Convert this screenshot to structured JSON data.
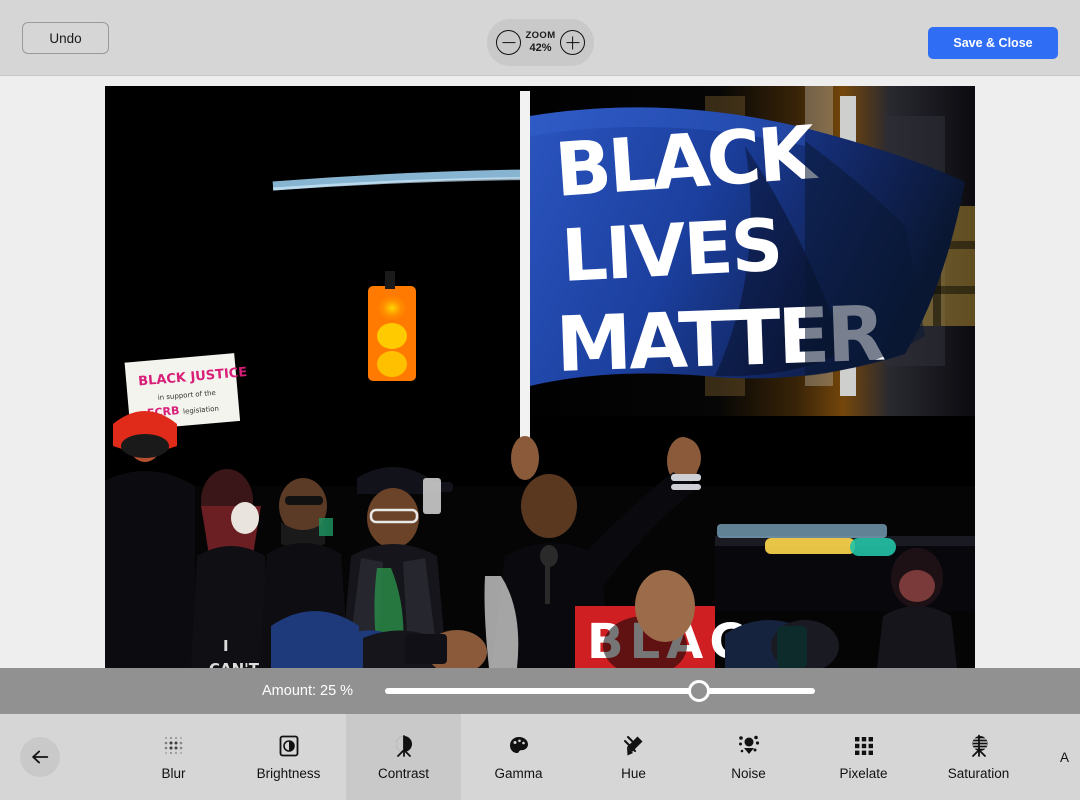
{
  "topbar": {
    "undo_label": "Undo",
    "zoom_label": "ZOOM",
    "zoom_value": "42%",
    "zoom_out_icon": "minus-circle-icon",
    "zoom_in_icon": "plus-circle-icon",
    "save_label": "Save & Close",
    "accent_color": "#2f6ef4"
  },
  "canvas": {
    "background_color": "#eeeeee",
    "photo": {
      "description": "Black Lives Matter protest rally at night",
      "flag_text_lines": [
        "BLACK",
        "LIVES",
        "MATTER"
      ],
      "flag_color": "#1b3f9e",
      "flag_text_color": "#ffffff",
      "sign_text_lines": [
        "BLACK JUSTICE",
        "in support of the",
        "ECRB legislation"
      ],
      "banner_text": "BLACK",
      "shirt_text_lines": [
        "I",
        "CAN'T"
      ],
      "traffic_light_color": "#ff8c00",
      "background_color": "#000000"
    }
  },
  "amount": {
    "label": "Amount: 25 %",
    "value": 25,
    "thumb_position_percent": 73,
    "bar_color": "#919191",
    "track_color": "#ffffff"
  },
  "filterbar": {
    "back_icon": "arrow-left-icon",
    "selected": "Contrast",
    "items": [
      {
        "label": "Blur",
        "icon": "dot-grid-icon"
      },
      {
        "label": "Brightness",
        "icon": "brightness-icon"
      },
      {
        "label": "Contrast",
        "icon": "contrast-icon"
      },
      {
        "label": "Gamma",
        "icon": "palette-icon"
      },
      {
        "label": "Hue",
        "icon": "hue-icon"
      },
      {
        "label": "Noise",
        "icon": "noise-icon"
      },
      {
        "label": "Pixelate",
        "icon": "pixel-grid-icon"
      },
      {
        "label": "Saturation",
        "icon": "saturation-icon"
      }
    ],
    "overflow_partial_label": "A"
  }
}
